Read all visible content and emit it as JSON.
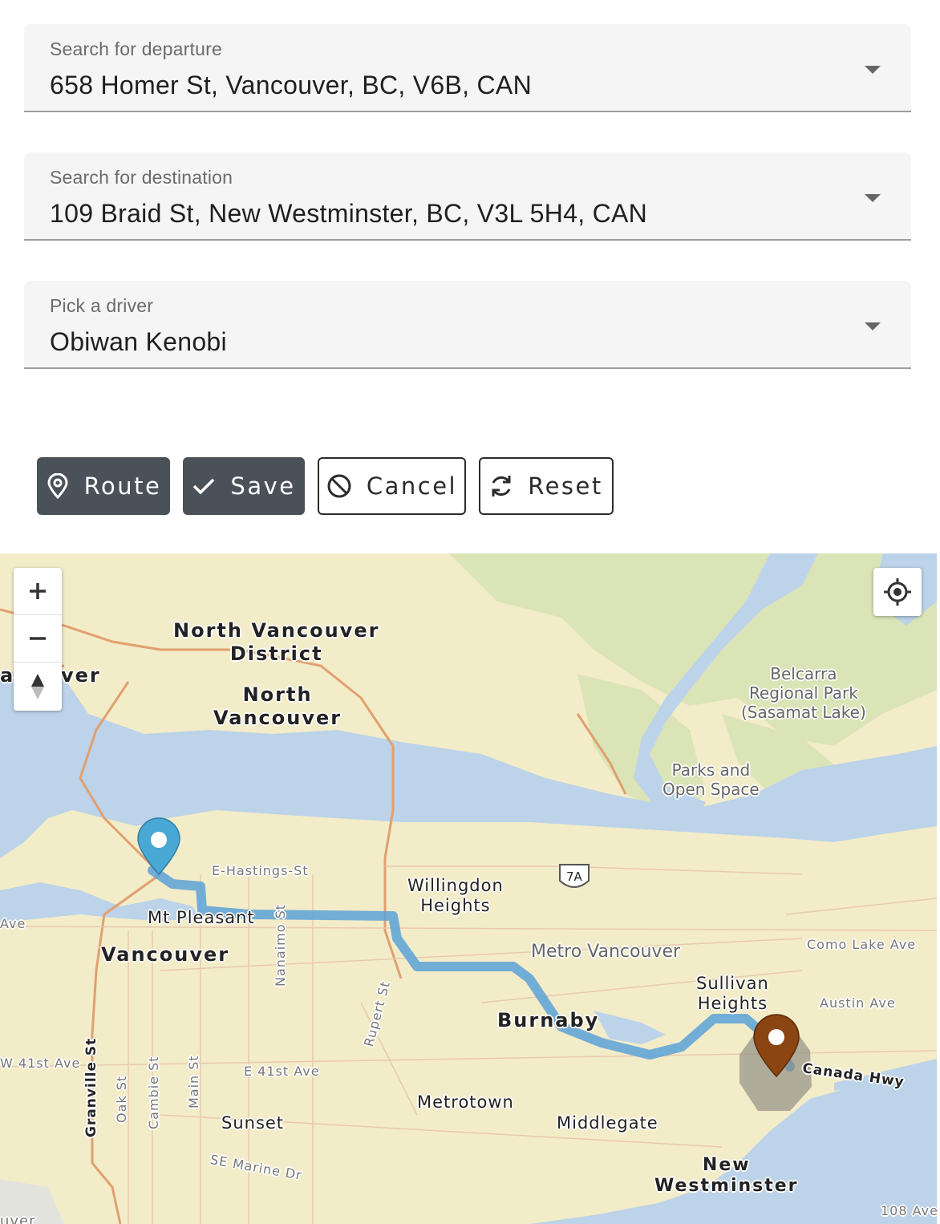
{
  "departure": {
    "label": "Search for departure",
    "value": "658 Homer St, Vancouver, BC, V6B, CAN"
  },
  "destination": {
    "label": "Search for destination",
    "value": "109 Braid St, New Westminster, BC, V3L 5H4, CAN"
  },
  "driver": {
    "label": "Pick a driver",
    "value": "Obiwan Kenobi"
  },
  "buttons": {
    "route": "Route",
    "save": "Save",
    "cancel": "Cancel",
    "reset": "Reset"
  },
  "map": {
    "labels": {
      "north_van_district": "North Vancouver\nDistrict",
      "north_vancouver": "North\nVancouver",
      "west_van": "ver",
      "west_van_left": "a",
      "belcarra": "Belcarra\nRegional Park\n(Sasamat Lake)",
      "parks": "Parks and\nOpen Space",
      "hastings": "E-Hastings-St",
      "highway_7a": "7A",
      "willingdon": "Willingdon\nHeights",
      "mt_pleasant": "Mt Pleasant",
      "vancouver": "Vancouver",
      "metro_vancouver": "Metro Vancouver",
      "como_lake": "Como Lake Ave",
      "ave_left": "Ave",
      "sullivan": "Sullivan\nHeights",
      "austin": "Austin Ave",
      "burnaby": "Burnaby",
      "nanaimo": "Nanaimo St",
      "rupert": "Rupert St",
      "canada_hwy": "Canada Hwy",
      "w41": "W 41st Ave",
      "granville": "Granville St",
      "oak": "Oak St",
      "cambie": "Cambie St",
      "main": "Main St",
      "e41": "E 41st Ave",
      "metrotown": "Metrotown",
      "middlegate": "Middlegate",
      "sunset": "Sunset",
      "se_marine": "SE Marine Dr",
      "new_west": "New\nWestminster",
      "ave108": "108 Ave",
      "bottom_left": "uver"
    },
    "colors": {
      "land": "#f3ecc8",
      "water": "#bcd3e9",
      "park": "#dbe4b6",
      "route": "#5aa2d8",
      "start_pin": "#4aa9d4",
      "end_pin": "#8b4513"
    },
    "icons": {
      "zoom_in": "plus-icon",
      "zoom_out": "minus-icon",
      "compass": "compass-icon",
      "locate": "locate-icon"
    }
  }
}
